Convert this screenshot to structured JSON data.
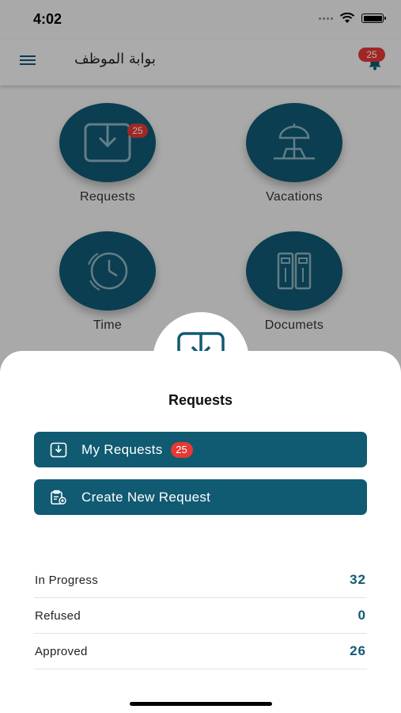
{
  "status_bar": {
    "time": "4:02"
  },
  "header": {
    "title": "بوابة الموظف",
    "notification_count": "25",
    "menu_icon": "hamburger-menu-icon",
    "bell_icon": "bell-icon"
  },
  "tiles": [
    {
      "label": "Requests",
      "badge": "25",
      "icon": "download-tray-icon"
    },
    {
      "label": "Vacations",
      "icon": "beach-umbrella-icon"
    },
    {
      "label": "Time",
      "icon": "clock-icon"
    },
    {
      "label": "Documets",
      "icon": "binders-icon"
    }
  ],
  "sheet": {
    "title": "Requests",
    "icon": "download-tray-icon",
    "buttons": [
      {
        "label": "My Requests",
        "badge": "25",
        "icon": "download-tray-icon"
      },
      {
        "label": "Create New Request",
        "icon": "clipboard-add-icon"
      }
    ],
    "stats": [
      {
        "label": "In Progress",
        "value": "32"
      },
      {
        "label": "Refused",
        "value": "0"
      },
      {
        "label": "Approved",
        "value": "26"
      }
    ]
  },
  "colors": {
    "primary": "#105a72",
    "badge": "#e53935",
    "overlay": "rgba(0,0,0,0.30)"
  }
}
